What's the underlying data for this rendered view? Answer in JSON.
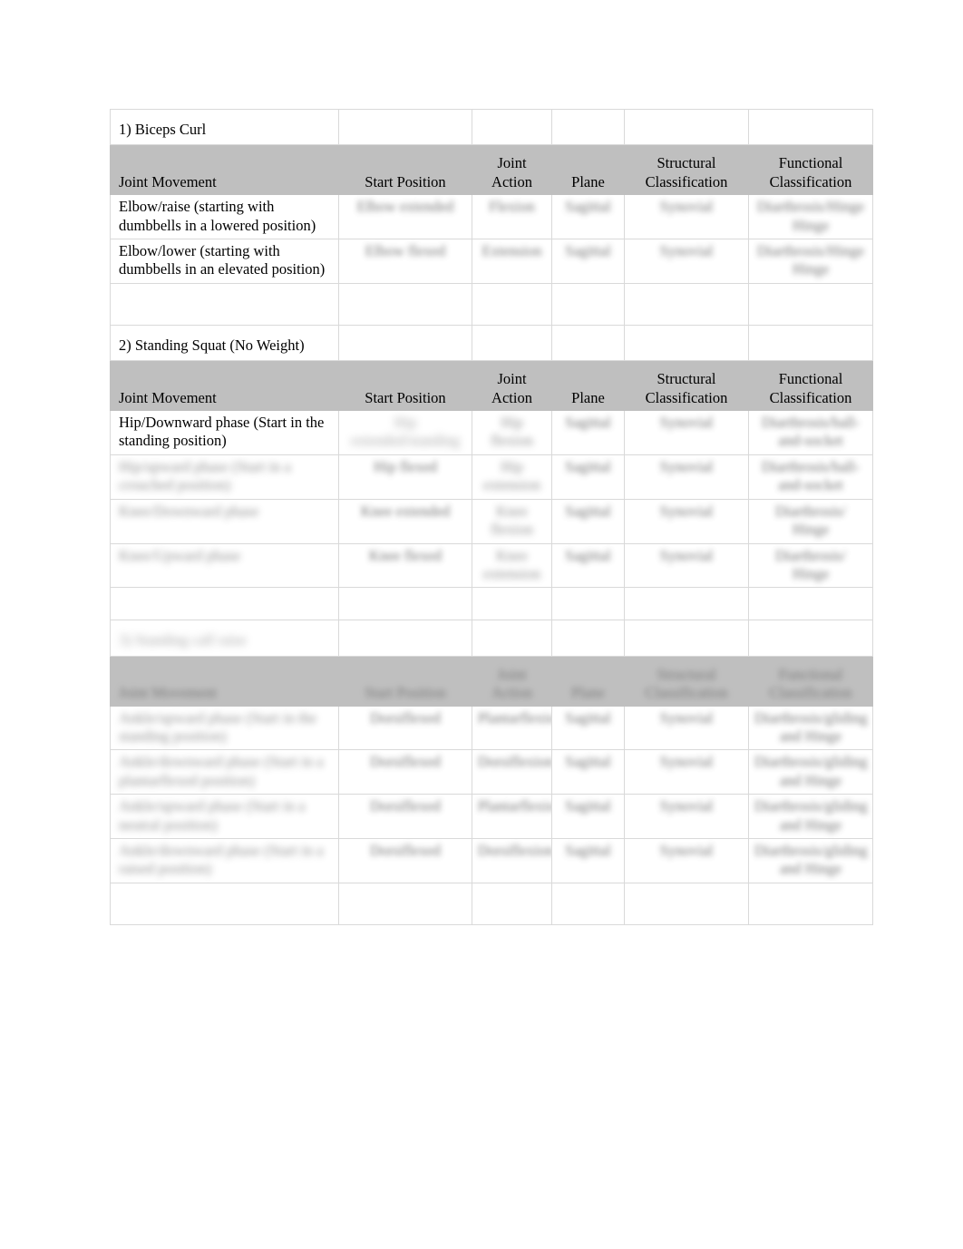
{
  "document": {
    "type": "kinesiology-joint-analysis-worksheet",
    "page_background": "#ffffff",
    "table_header_shade": "#bfbfbf",
    "table_border_color": "#d9d9d9"
  },
  "columns": {
    "joint_movement": "Joint Movement",
    "start_position": "Start Position",
    "joint_action_line1": "Joint",
    "joint_action_line2": "Action",
    "plane": "Plane",
    "structural_line1": "Structural",
    "structural_line2": "Classification",
    "functional_line1": "Functional",
    "functional_line2": "Classification"
  },
  "sections": [
    {
      "id": "biceps-curl",
      "title": "1) Biceps Curl",
      "rows": [
        {
          "joint_movement": "Elbow/raise (starting with dumbbells in a lowered position)",
          "start_position": "Elbow extended",
          "joint_action": "Flexion",
          "plane": "Sagittal",
          "structural": "Synovial",
          "functional_line1": "Diarthrosis/Hinge",
          "functional_line2": "Hinge",
          "redacted": true
        },
        {
          "joint_movement": "Elbow/lower (starting with dumbbells in an elevated position)",
          "start_position": "Elbow flexed",
          "joint_action": "Extension",
          "plane": "Sagittal",
          "structural": "Synovial",
          "functional_line1": "Diarthrosis/Hinge",
          "functional_line2": "Hinge",
          "redacted": true
        }
      ]
    },
    {
      "id": "standing-squat",
      "title": "2) Standing Squat (No Weight)",
      "rows": [
        {
          "joint_movement": "Hip/Downward phase (Start in the standing position)",
          "start_position": "Hip extended/standing",
          "joint_action_line1": "Hip",
          "joint_action_line2": "flexion",
          "plane": "Sagittal",
          "structural": "Synovial",
          "functional_line1": "Diarthrosis/ball-",
          "functional_line2": "and-socket",
          "redacted": true,
          "movement_redacted": false
        },
        {
          "joint_movement": "Hip/upward phase (Start in a crouched position)",
          "start_position": "Hip flexed",
          "joint_action_line1": "Hip",
          "joint_action_line2": "extension",
          "plane": "Sagittal",
          "structural": "Synovial",
          "functional_line1": "Diarthrosis/ball-",
          "functional_line2": "and-socket",
          "redacted": true,
          "movement_redacted": true
        },
        {
          "joint_movement": "Knee/Downward phase",
          "start_position": "Knee extended",
          "joint_action_line1": "Knee",
          "joint_action_line2": "flexion",
          "plane": "Sagittal",
          "structural": "Synovial",
          "functional_line1": "Diarthrosis/",
          "functional_line2": "Hinge",
          "redacted": true,
          "movement_redacted": true
        },
        {
          "joint_movement": "Knee/Upward phase",
          "start_position": "Knee flexed",
          "joint_action_line1": "Knee",
          "joint_action_line2": "extension",
          "plane": "Sagittal",
          "structural": "Synovial",
          "functional_line1": "Diarthrosis/",
          "functional_line2": "Hinge",
          "redacted": true,
          "movement_redacted": true
        }
      ]
    },
    {
      "id": "third-exercise",
      "title": "3) Standing calf raise",
      "title_redacted": true,
      "header_redacted": true,
      "rows": [
        {
          "joint_movement": "Ankle/upward phase (Start in the standing position)",
          "start_position": "Dorsiflexed",
          "joint_action": "Plantarflexion",
          "plane": "Sagittal",
          "structural": "Synovial",
          "functional_line1": "Diarthrosis/gliding",
          "functional_line2": "and Hinge",
          "redacted": true,
          "movement_redacted": true
        },
        {
          "joint_movement": "Ankle/downward phase (Start in a plantarflexed position)",
          "start_position": "Dorsiflexed",
          "joint_action": "Dorsiflexion",
          "plane": "Sagittal",
          "structural": "Synovial",
          "functional_line1": "Diarthrosis/gliding",
          "functional_line2": "and Hinge",
          "redacted": true,
          "movement_redacted": true
        },
        {
          "joint_movement": "Ankle/upward phase (Start in a neutral position)",
          "start_position": "Dorsiflexed",
          "joint_action": "Plantarflexion",
          "plane": "Sagittal",
          "structural": "Synovial",
          "functional_line1": "Diarthrosis/gliding",
          "functional_line2": "and Hinge",
          "redacted": true,
          "movement_redacted": true
        },
        {
          "joint_movement": "Ankle/downward phase (Start in a raised position)",
          "start_position": "Dorsiflexed",
          "joint_action": "Dorsiflexion",
          "plane": "Sagittal",
          "structural": "Synovial",
          "functional_line1": "Diarthrosis/gliding",
          "functional_line2": "and Hinge",
          "redacted": true,
          "movement_redacted": true
        }
      ]
    }
  ]
}
